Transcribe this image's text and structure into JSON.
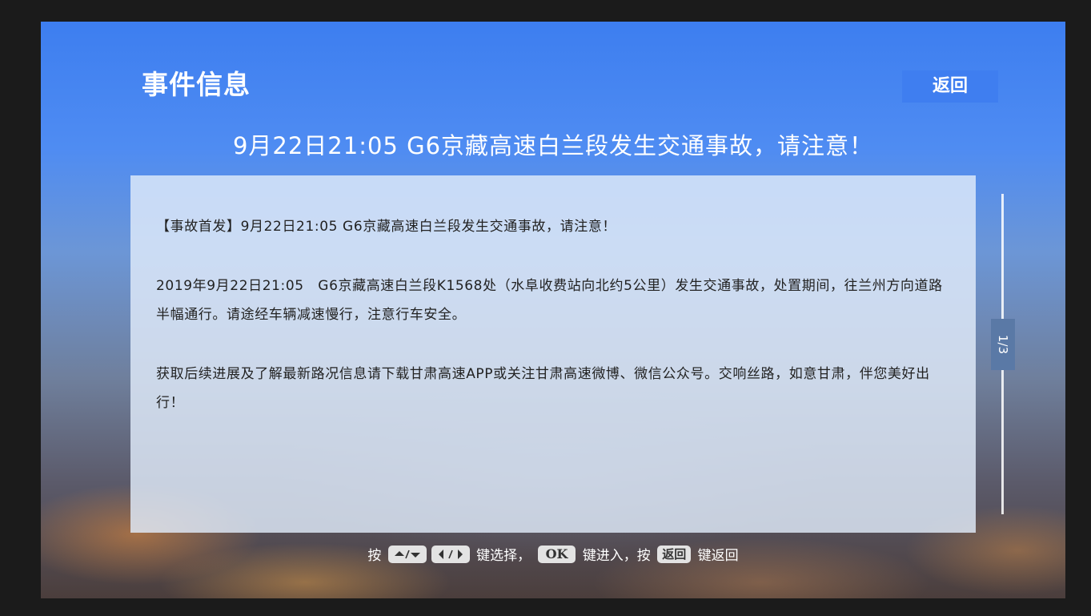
{
  "header": {
    "title": "事件信息",
    "back_label": "返回"
  },
  "headline": "9月22日21:05 G6京藏高速白兰段发生交通事故，请注意！",
  "content": {
    "paragraphs": [
      "【事故首发】9月22日21:05 G6京藏高速白兰段发生交通事故，请注意！",
      "2019年9月22日21:05　G6京藏高速白兰段K1568处（水阜收费站向北约5公里）发生交通事故，处置期间，往兰州方向道路半幅通行。请途经车辆减速慢行，注意行车安全。",
      "获取后续进展及了解最新路况信息请下载甘肃高速APP或关注甘肃高速微博、微信公众号。交响丝路，如意甘肃，伴您美好出行！"
    ]
  },
  "pagination": {
    "indicator": "1/3"
  },
  "footer": {
    "press": "按",
    "select_suffix": "键选择，",
    "ok_key": "OK",
    "enter_suffix": "键进入，按",
    "back_key": "返回",
    "back_suffix": "键返回"
  },
  "icons": {
    "up_down": "up-down-arrows-icon",
    "left_right": "left-right-arrows-icon"
  },
  "colors": {
    "back_button": "#3f7ef0",
    "panel": "#e1ecfa",
    "indicator": "#5a79a6"
  }
}
